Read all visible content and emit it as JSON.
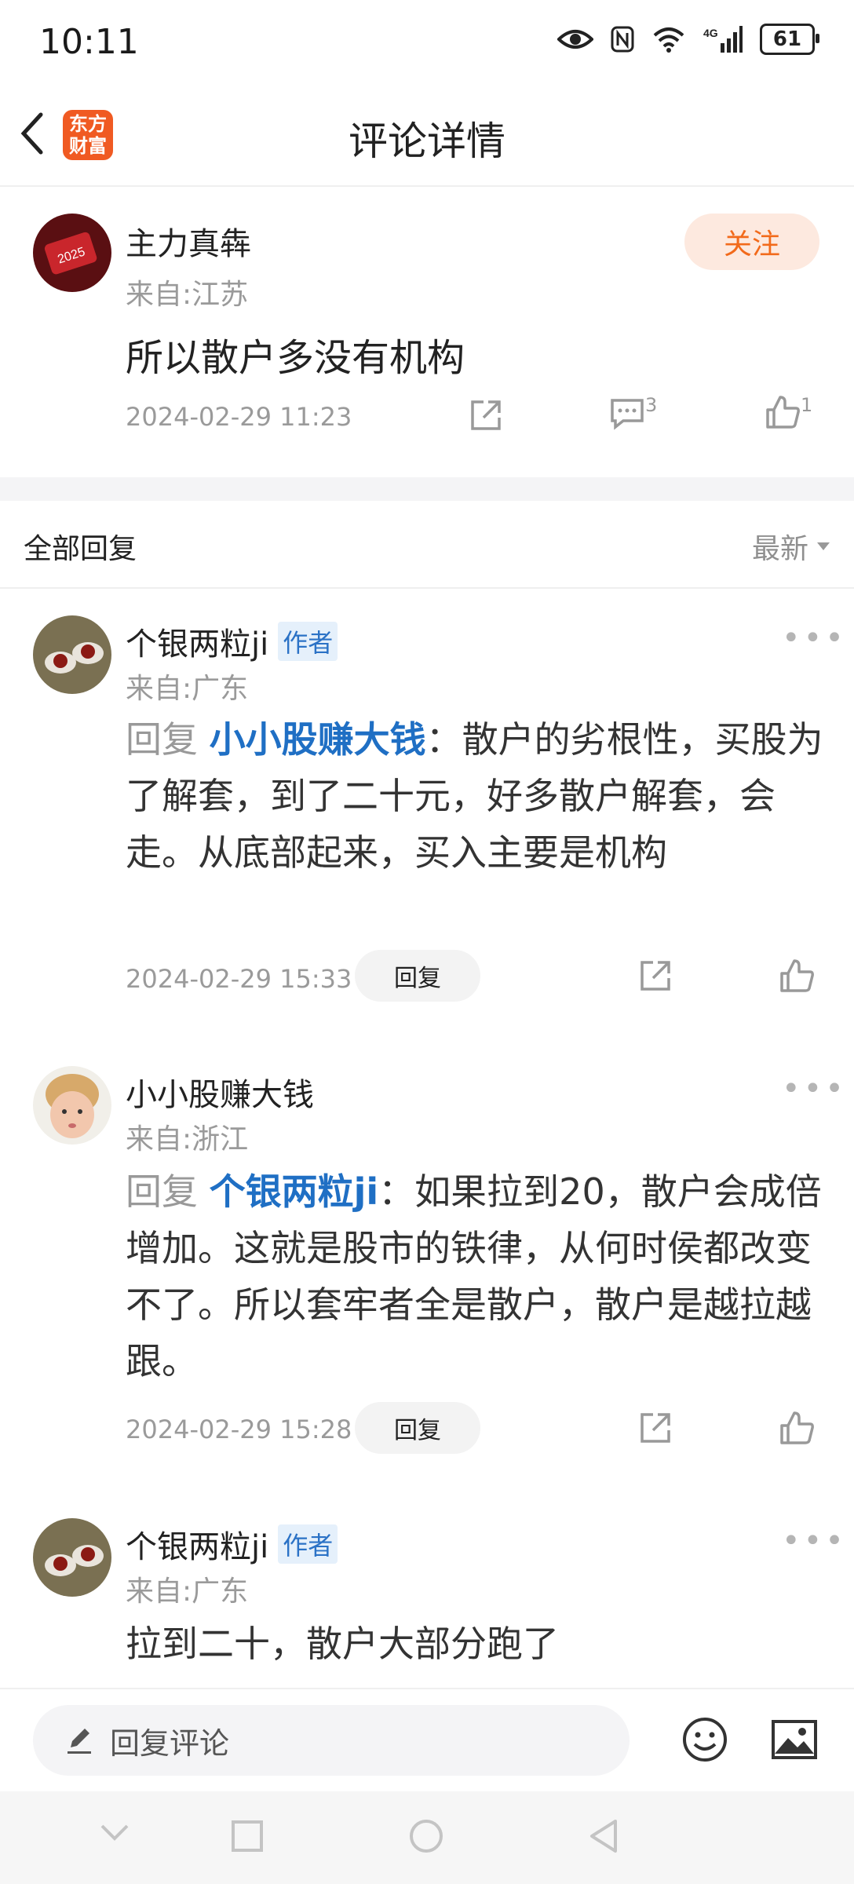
{
  "status": {
    "time": "10:11",
    "battery": "61",
    "network": "4G"
  },
  "header": {
    "title": "评论详情",
    "logo_line1": "东方",
    "logo_line2": "财富"
  },
  "post": {
    "user": "主力真犇",
    "location": "来自:江苏",
    "follow_label": "关注",
    "text": "所以散户多没有机构",
    "timestamp": "2024-02-29 11:23",
    "comment_count": "3",
    "like_count": "1"
  },
  "replies_section": {
    "title": "全部回复",
    "sort_label": "最新"
  },
  "replies": [
    {
      "user": "个银两粒ji",
      "tag": "作者",
      "location": "来自:广东",
      "prefix": "回复 ",
      "target": "小小股赚大钱",
      "text": "：散户的劣根性，买股为了解套，到了二十元，好多散户解套，会走。从底部起来，买入主要是机构",
      "timestamp": "2024-02-29 15:33",
      "reply_label": "回复"
    },
    {
      "user": "小小股赚大钱",
      "tag": "",
      "location": "来自:浙江",
      "prefix": "回复 ",
      "target": "个银两粒ji",
      "text": "：如果拉到20，散户会成倍增加。这就是股市的铁律，从何时侯都改变不了。所以套牢者全是散户，散户是越拉越跟。",
      "timestamp": "2024-02-29 15:28",
      "reply_label": "回复"
    },
    {
      "user": "个银两粒ji",
      "tag": "作者",
      "location": "来自:广东",
      "text": "拉到二十，散户大部分跑了"
    }
  ],
  "bottom": {
    "input_placeholder": "回复评论"
  }
}
